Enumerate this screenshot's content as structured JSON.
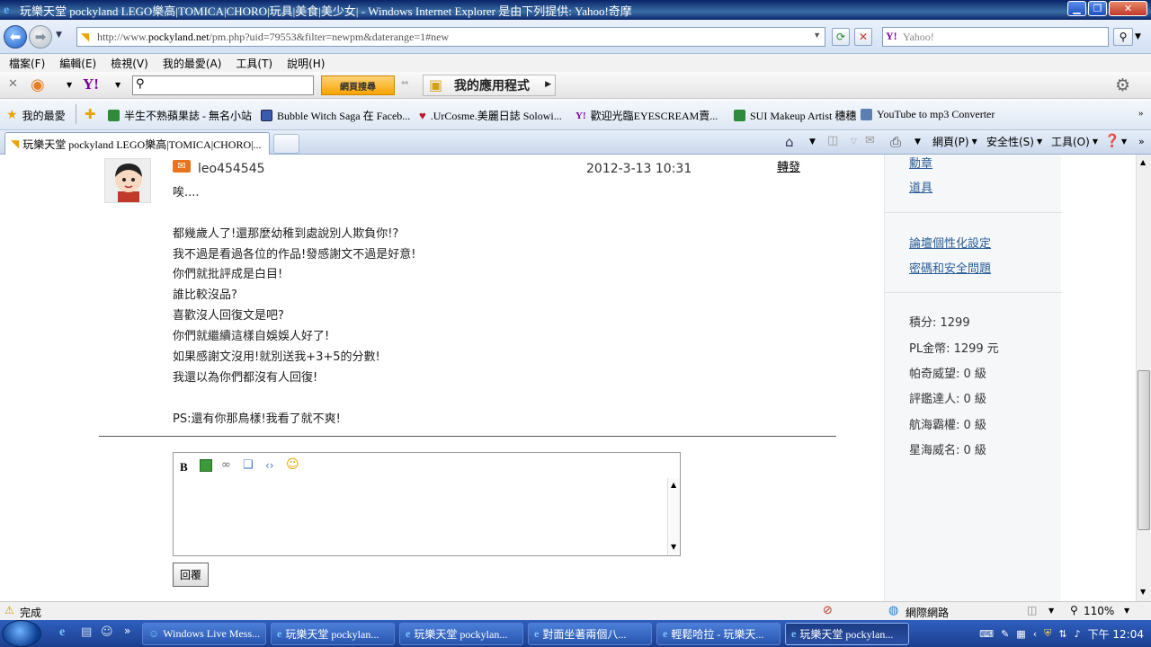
{
  "window": {
    "title": "玩樂天堂 pockyland LEGO樂高|TOMICA|CHORO|玩具|美食|美少女| - Windows Internet Explorer 是由下列提供: Yahoo!奇摩"
  },
  "address_bar": {
    "url_prefix": "http://www.",
    "url_domain": "pockyland.net",
    "url_path": "/pm.php?uid=79553&filter=newpm&daterange=1#new",
    "search_placeholder": "Yahoo!"
  },
  "menu": [
    "檔案(F)",
    "編輯(E)",
    "檢視(V)",
    "我的最愛(A)",
    "工具(T)",
    "說明(H)"
  ],
  "toolbar2": {
    "find_button": "網頁搜尋",
    "apps_label": "我的應用程式"
  },
  "favorites": {
    "label": "我的最愛",
    "items": [
      "半生不熟蘋果誌 - 無名小站",
      "Bubble Witch Saga 在 Faceb...",
      ".UrCosme.美麗日誌 Solowi...",
      "歡迎光臨EYESCREAM賣...",
      "SUI Makeup Artist 穗穗",
      "YouTube to mp3 Converter"
    ]
  },
  "tab": {
    "title": "玩樂天堂 pockyland LEGO樂高|TOMICA|CHORO|..."
  },
  "commands": {
    "page": "網頁(P)",
    "safety": "安全性(S)",
    "tools": "工具(O)"
  },
  "message": {
    "author": "leo454545",
    "date": "2012-3-13 10:31",
    "forward": "轉發",
    "lines": [
      "唉....",
      "",
      "都幾歲人了!還那麼幼稚到處說別人欺負你!?",
      "我不過是看過各位的作品!發感謝文不過是好意!",
      "你們就批評成是白目!",
      "誰比較沒品?",
      "喜歡沒人回復文是吧?",
      "你們就繼續這樣自娛娛人好了!",
      "如果感謝文沒用!就別送我+3+5的分數!",
      "我還以為你們都沒有人回復!",
      "",
      "PS:還有你那鳥樣!我看了就不爽!"
    ],
    "reply_button": "回覆"
  },
  "sidebar": {
    "link_top_partial": "勳章",
    "link_items": "道具",
    "link_forum_settings": "論壇個性化設定",
    "link_password": "密碼和安全問題",
    "stats": [
      "積分: 1299",
      "PL金幣: 1299 元",
      "帕奇威望: 0 級",
      "評鑑達人: 0 級",
      "航海霸權: 0 級",
      "星海威名: 0 級"
    ]
  },
  "statusbar": {
    "status": "完成",
    "zone": "網際網路",
    "zoom": "110%"
  },
  "taskbar": {
    "tasks": [
      "Windows Live Mess...",
      "玩樂天堂 pockylan...",
      "玩樂天堂 pockylan...",
      "對面坐著兩個八...",
      "輕鬆哈拉 - 玩樂天...",
      "玩樂天堂 pockylan..."
    ],
    "clock": "下午 12:04"
  },
  "colors": {
    "link": "#2b5d97",
    "titlebar": "#0a246a",
    "taskbar": "#1b3f8e"
  }
}
